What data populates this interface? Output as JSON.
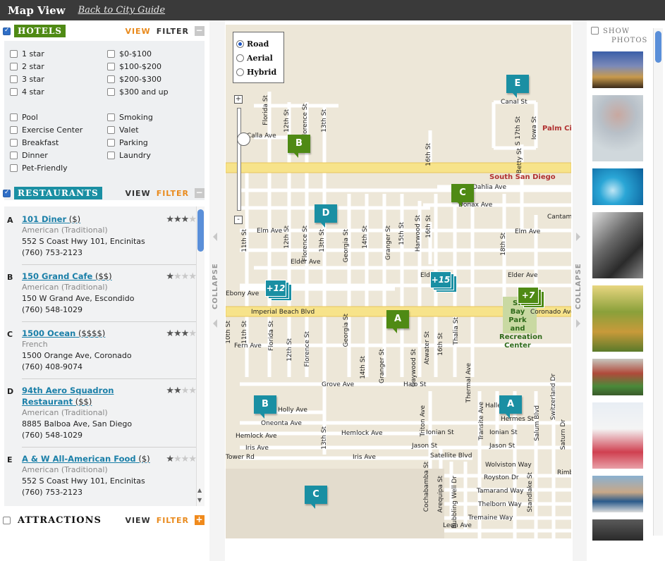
{
  "header": {
    "title": "Map View",
    "back_link": "Back to City Guide"
  },
  "hotels": {
    "label": "HOTELS",
    "view": "VIEW",
    "filter": "FILTER",
    "toggle": "−",
    "options_left": [
      "1 star",
      "2 star",
      "3 star",
      "4 star"
    ],
    "options_right": [
      "$0-$100",
      "$100-$200",
      "$200-$300",
      "$300 and up"
    ],
    "amenities_left": [
      "Pool",
      "Exercise Center",
      "Breakfast",
      "Dinner",
      "Pet-Friendly"
    ],
    "amenities_right": [
      "Smoking",
      "Valet",
      "Parking",
      "Laundry"
    ]
  },
  "restaurants": {
    "label": "RESTAURANTS",
    "view": "VIEW",
    "filter": "FILTER",
    "toggle": "−",
    "items": [
      {
        "letter": "A",
        "name": "101 Diner",
        "name2": "",
        "price": " ($)",
        "cuisine": "American (Traditional)",
        "address": "552 S Coast Hwy 101, Encinitas",
        "phone": "(760) 753-2123",
        "rating": 3
      },
      {
        "letter": "B",
        "name": "150 Grand Cafe",
        "name2": "",
        "price": " ($$)",
        "cuisine": "American (Traditional)",
        "address": "150 W Grand Ave, Escondido",
        "phone": "(760) 548-1029",
        "rating": 1
      },
      {
        "letter": "C",
        "name": "1500 Ocean",
        "name2": "",
        "price": " ($$$$)",
        "cuisine": "French",
        "address": "1500 Orange Ave, Coronado",
        "phone": "(760) 408-9074",
        "rating": 3
      },
      {
        "letter": "D",
        "name": "94th Aero Squadron",
        "name2": "Restaurant",
        "price": " ($$)",
        "cuisine": "American (Traditional)",
        "address": "8885 Balboa Ave, San Diego",
        "phone": "(760) 548-1029",
        "rating": 2
      },
      {
        "letter": "E",
        "name": "A & W All-American Food",
        "name2": "",
        "price": " ($)",
        "cuisine": "American (Traditional)",
        "address": "552 S Coast Hwy 101, Encinitas",
        "phone": "(760) 753-2123",
        "rating": 1
      }
    ]
  },
  "attractions": {
    "label": "ATTRACTIONS",
    "view": "VIEW",
    "filter": "FILTER",
    "toggle": "+"
  },
  "collapse": {
    "label": "COLLAPSE"
  },
  "map": {
    "types": [
      "Road",
      "Aerial",
      "Hybrid"
    ],
    "selected_type": "Road",
    "zoom_in": "+",
    "zoom_out": "-",
    "markers": {
      "green_b": "B",
      "green_c": "C",
      "green_a": "A",
      "teal_e": "E",
      "teal_d": "D",
      "teal_b": "B",
      "teal_a": "A",
      "teal_c": "C"
    },
    "clusters": {
      "c12": "+12",
      "c15": "+15",
      "c7": "+7"
    },
    "streets": {
      "florida_st_n": "Florida St",
      "st12_n": "12th St",
      "florence_n": "Florence St",
      "st13_n": "13th St",
      "calla": "Calla Ave",
      "palm_city": "Palm Cit",
      "south_sd": "South San Diego",
      "canal": "Canal St",
      "st17": "S 17th St",
      "iowa": "Iowa St",
      "betty": "Betty St",
      "st16_n": "16th St",
      "dahlia": "Dahlia Ave",
      "donax": "Donax Ave",
      "cantamar": "Cantamar",
      "elm_w": "Elm Ave",
      "elm_e": "Elm Ave",
      "elder_w": "Elder Ave",
      "elder_m": "Eld",
      "elder_e": "Elder Ave",
      "st11_m": "11th St",
      "st12_m": "12th St",
      "florence_m": "Florence St",
      "st13_m": "13th St",
      "georgia_m": "Georgia St",
      "st14_m": "14th St",
      "granger_m": "Granger St",
      "st15_m": "15th St",
      "harwood": "Harwood St",
      "st16_m": "16th St",
      "st18_m": "18th St",
      "ebony": "Ebony Ave",
      "imperial": "Imperial Beach Blvd",
      "coronado": "Coronado Ave",
      "park1": "So",
      "park2": "Bay",
      "park3": "Park",
      "park4": "and",
      "park5": "Recreation",
      "park6": "Center",
      "st10_s": "10th St",
      "st11_s": "11th St",
      "florida_s": "Florida St",
      "st12_s": "12th St",
      "florence_s": "Florence St",
      "fern": "Fern Ave",
      "georgia_s": "Georgia St",
      "st14_s": "14th St",
      "granger_s": "Granger St",
      "gaywood": "Gaywood St",
      "atwater": "Atwater St",
      "st16_s": "16th St",
      "thalia": "Thalia St",
      "grove": "Grove Ave",
      "halo": "Halo St",
      "thermal": "Thermal Ave",
      "switzerland": "Switzerland Dr",
      "holly": "Holly Ave",
      "oneonta": "Oneonta Ave",
      "hemlock_w": "Hemlock Ave",
      "hemlock_m": "Hemlock Ave",
      "iris_w": "Iris Ave",
      "iris_m": "Iris Ave",
      "tower": "Tower Rd",
      "st13_s": "13th St",
      "hermes": "Hermes St",
      "hallee": "Halle",
      "ionian_w": "Ionian St",
      "ionian_e": "Ionian St",
      "jason_w": "Jason St",
      "jason_e": "Jason St",
      "satellite": "Satellite Blvd",
      "triton": "Triton Ave",
      "transite": "Transite Ave",
      "salum": "Salum Blvd",
      "saturn": "Saturn Dr",
      "wolviston": "Wolviston Way",
      "royston": "Royston Dr",
      "tamarand": "Tamarand Way",
      "thelborn": "Thelborn Way",
      "tremaine": "Tremaine Way",
      "leon": "Leon Ave",
      "cochabamba": "Cochabamba St",
      "arequipa": "Arequipa St",
      "bubbling": "Bubbling Well Dr",
      "standlake": "Standlake St",
      "rimb": "Rimb"
    }
  },
  "photos": {
    "label_line1": "SHOW",
    "label_line2": "PHOTOS"
  },
  "colors": {
    "hotel_green": "#4f8a14",
    "restaurant_teal": "#1a8fa3",
    "accent_orange": "#e98a1c",
    "road_yellow": "#f7e38a"
  }
}
